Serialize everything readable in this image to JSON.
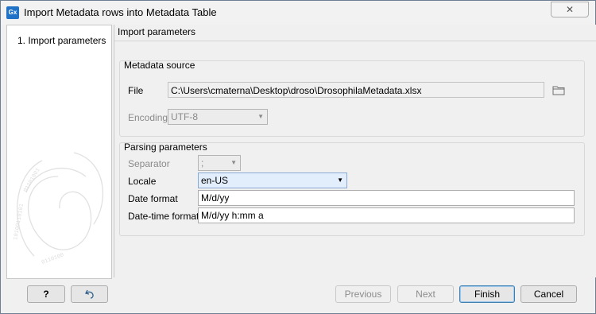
{
  "window": {
    "title": "Import Metadata rows into Metadata Table",
    "app_icon_label": "Gx",
    "close_glyph": "✕"
  },
  "steps": {
    "items": [
      {
        "label": "1.   Import parameters"
      }
    ]
  },
  "page": {
    "title": "Import parameters"
  },
  "metadata_source": {
    "title": "Metadata source",
    "file_label": "File",
    "file_value": "C:\\Users\\cmaterna\\Desktop\\droso\\DrosophilaMetadata.xlsx",
    "encoding_label": "Encoding",
    "encoding_value": "UTF-8"
  },
  "parsing": {
    "title": "Parsing parameters",
    "separator_label": "Separator",
    "separator_value": ";",
    "locale_label": "Locale",
    "locale_value": "en-US",
    "date_format_label": "Date format",
    "date_format_value": "M/d/yy",
    "datetime_format_label": "Date-time format",
    "datetime_format_value": "M/d/yy h:mm a"
  },
  "buttons": {
    "help": "?",
    "previous": "Previous",
    "next": "Next",
    "finish": "Finish",
    "cancel": "Cancel"
  },
  "icons": {
    "app": "app-icon",
    "close": "close-icon",
    "folder": "folder-icon",
    "reset": "undo-icon",
    "dropdown": "chevron-down-icon"
  },
  "colors": {
    "app_icon": "#1f72c6",
    "locale_highlight": "#e3eefc",
    "primary_border": "#3c7fb1"
  }
}
